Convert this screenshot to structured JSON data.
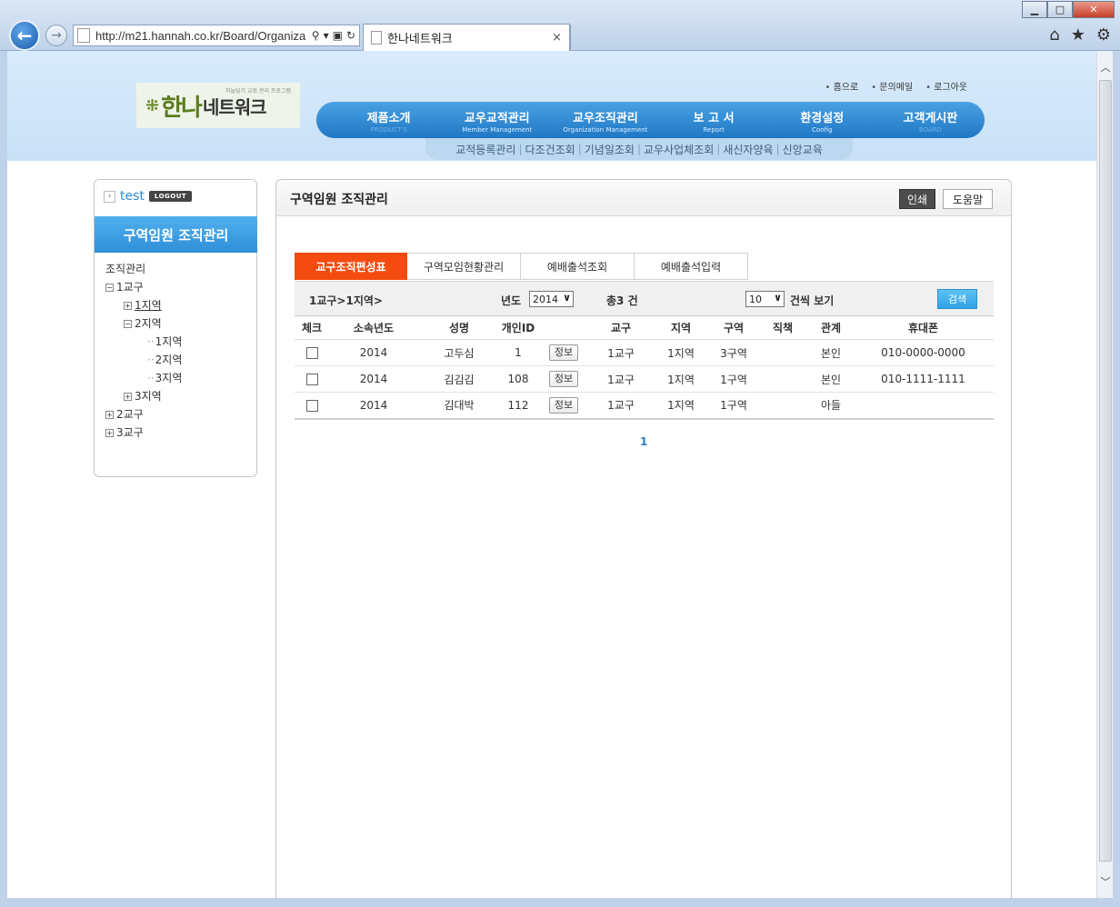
{
  "browser": {
    "url": "http://m21.hannah.co.kr/Board/Organiza",
    "tab_title": "한나네트워크",
    "tab_close": "×"
  },
  "site": {
    "logo": {
      "big": "한나",
      "small": "네트워크",
      "tagline": "하늘담기 교회 관리 프로그램"
    },
    "util_links": [
      "홈으로",
      "문의메일",
      "로그아웃"
    ],
    "gnb": [
      {
        "ko": "제품소개",
        "en": "PRODUCT'S"
      },
      {
        "ko": "교우교적관리",
        "en": "Member Management"
      },
      {
        "ko": "교우조직관리",
        "en": "Organization Management"
      },
      {
        "ko": "보 고 서",
        "en": "Report"
      },
      {
        "ko": "환경설정",
        "en": "Config"
      },
      {
        "ko": "고객게시판",
        "en": "BOARD"
      }
    ],
    "sub_gnb": [
      "교적등록관리",
      "다조건조회",
      "기념일조회",
      "교우사업체조회",
      "새신자양육",
      "신앙교육"
    ]
  },
  "sidebar": {
    "user": "test",
    "logout": "LOGOUT",
    "title": "구역임원 조직관리",
    "tree": {
      "root": "조직관리",
      "g1": "1교구",
      "g1_r1": "1지역",
      "g1_r2": "2지역",
      "g1_r2_a": "1지역",
      "g1_r2_b": "2지역",
      "g1_r2_c": "3지역",
      "g1_r3": "3지역",
      "g2": "2교구",
      "g3": "3교구"
    }
  },
  "main": {
    "title": "구역임원 조직관리",
    "print": "인쇄",
    "help": "도움말",
    "tabs": [
      "교구조직편성표",
      "구역모임현황관리",
      "예배출석조회",
      "예배출석입력"
    ],
    "filter": {
      "breadcrumb": "1교구>1지역>",
      "year_label": "년도",
      "year_value": "2014",
      "total": "총3 건",
      "rows_value": "10",
      "rows_label": "건씩 보기",
      "search": "검색"
    },
    "columns": [
      "체크",
      "소속년도",
      "성명",
      "개인ID",
      "",
      "교구",
      "지역",
      "구역",
      "직책",
      "관계",
      "휴대폰"
    ],
    "info_label": "정보",
    "rows": [
      {
        "year": "2014",
        "name": "고두심",
        "id": "1",
        "parish": "1교구",
        "region": "1지역",
        "district": "3구역",
        "role": "",
        "relation": "본인",
        "phone": "010-0000-0000"
      },
      {
        "year": "2014",
        "name": "김김김",
        "id": "108",
        "parish": "1교구",
        "region": "1지역",
        "district": "1구역",
        "role": "",
        "relation": "본인",
        "phone": "010-1111-1111"
      },
      {
        "year": "2014",
        "name": "김대박",
        "id": "112",
        "parish": "1교구",
        "region": "1지역",
        "district": "1구역",
        "role": "",
        "relation": "아들",
        "phone": ""
      }
    ],
    "page": "1"
  }
}
